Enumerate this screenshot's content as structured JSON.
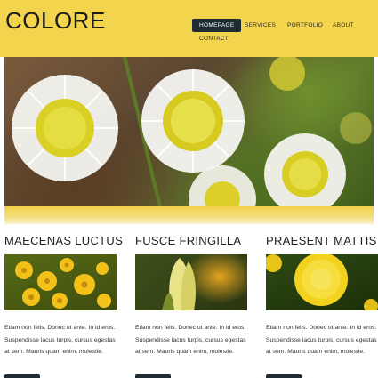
{
  "header": {
    "logo": "COLORE",
    "nav": [
      {
        "label": "HOMEPAGE",
        "active": true
      },
      {
        "label": "SERVICES",
        "active": false
      },
      {
        "label": "PORTFOLIO",
        "active": false
      },
      {
        "label": "ABOUT",
        "active": false
      },
      {
        "label": "CONTACT",
        "active": false
      }
    ]
  },
  "colors": {
    "header_bg": "#f3d54d",
    "nav_active_bg": "#1f2b33",
    "text": "#222222"
  },
  "columns": [
    {
      "title": "MAECENAS LUCTUS",
      "text": "Etiam non felis. Donec ut ante. In id eros. Suspendisse lacus turpis, cursus egestas at sem. Mauris quam enim, molestie.",
      "image": "yellow-daisies-photo"
    },
    {
      "title": "FUSCE FRINGILLA",
      "text": "Etiam non felis. Donec ut ante. In id eros. Suspendisse lacus turpis, cursus egestas at sem. Mauris quam enim, molestie.",
      "image": "tulip-bud-photo"
    },
    {
      "title": "PRAESENT MATTIS",
      "text": "Etiam non felis. Donec ut ante. In id eros. Suspendisse lacus turpis, cursus egestas at sem. Mauris quam enim, molestie.",
      "image": "marigold-photo"
    }
  ],
  "hero": {
    "image": "white-daisies-photo"
  }
}
